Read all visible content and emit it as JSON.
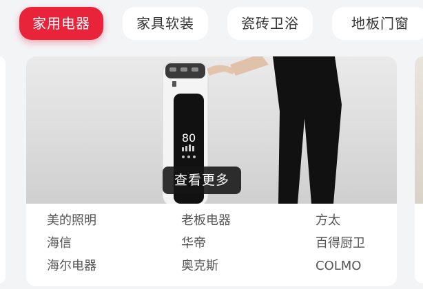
{
  "tabs": [
    {
      "label": "家用电器",
      "active": true
    },
    {
      "label": "家具软装",
      "active": false
    },
    {
      "label": "瓷砖卫浴",
      "active": false
    },
    {
      "label": "地板门窗",
      "active": false
    }
  ],
  "hero": {
    "display_value": "80",
    "more_label": "查看更多"
  },
  "brands": [
    "美的照明",
    "老板电器",
    "方太",
    "海信",
    "华帝",
    "百得厨卫",
    "海尔电器",
    "奥克斯",
    "COLMO"
  ],
  "colors": {
    "accent": "#e8233a",
    "background": "#f3f4f6"
  }
}
